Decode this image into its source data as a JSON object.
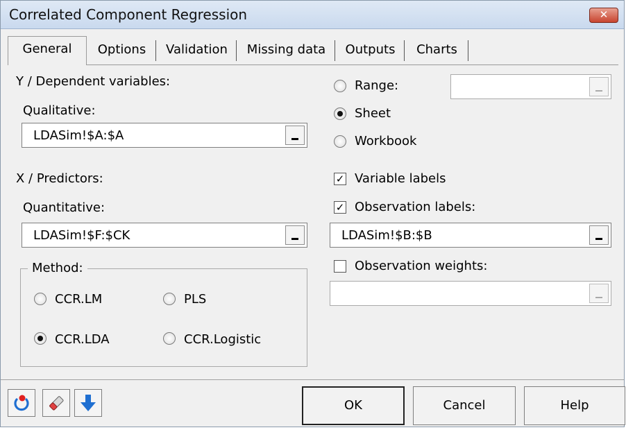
{
  "window": {
    "title": "Correlated Component Regression",
    "close_glyph": "✕"
  },
  "tabs": [
    {
      "label": "General"
    },
    {
      "label": "Options"
    },
    {
      "label": "Validation"
    },
    {
      "label": "Missing data"
    },
    {
      "label": "Outputs"
    },
    {
      "label": "Charts"
    }
  ],
  "y_section": {
    "heading": "Y / Dependent variables:",
    "type_label": "Qualitative:",
    "value": "LDASim!$A:$A"
  },
  "x_section": {
    "heading": "X / Predictors:",
    "type_label": "Quantitative:",
    "value": "LDASim!$F:$CK"
  },
  "method": {
    "legend": "Method:",
    "options": [
      {
        "label": "CCR.LM",
        "checked": false
      },
      {
        "label": "PLS",
        "checked": false
      },
      {
        "label": "CCR.LDA",
        "checked": true
      },
      {
        "label": "CCR.Logistic",
        "checked": false
      }
    ]
  },
  "output_target": {
    "options": [
      {
        "label": "Range:",
        "checked": false
      },
      {
        "label": "Sheet",
        "checked": true
      },
      {
        "label": "Workbook",
        "checked": false
      }
    ],
    "range_value": ""
  },
  "labels": {
    "variable_labels": {
      "label": "Variable labels",
      "checked": true
    },
    "observation_labels": {
      "label": "Observation labels:",
      "checked": true,
      "value": "LDASim!$B:$B"
    },
    "observation_weights": {
      "label": "Observation weights:",
      "checked": false,
      "value": ""
    }
  },
  "buttons": {
    "ok": "OK",
    "cancel": "Cancel",
    "help": "Help",
    "icons": [
      "reset-icon",
      "eraser-icon",
      "down-arrow-icon"
    ]
  },
  "colors": {
    "accent_blue": "#1f6fd1",
    "close_red": "#c8442f"
  }
}
